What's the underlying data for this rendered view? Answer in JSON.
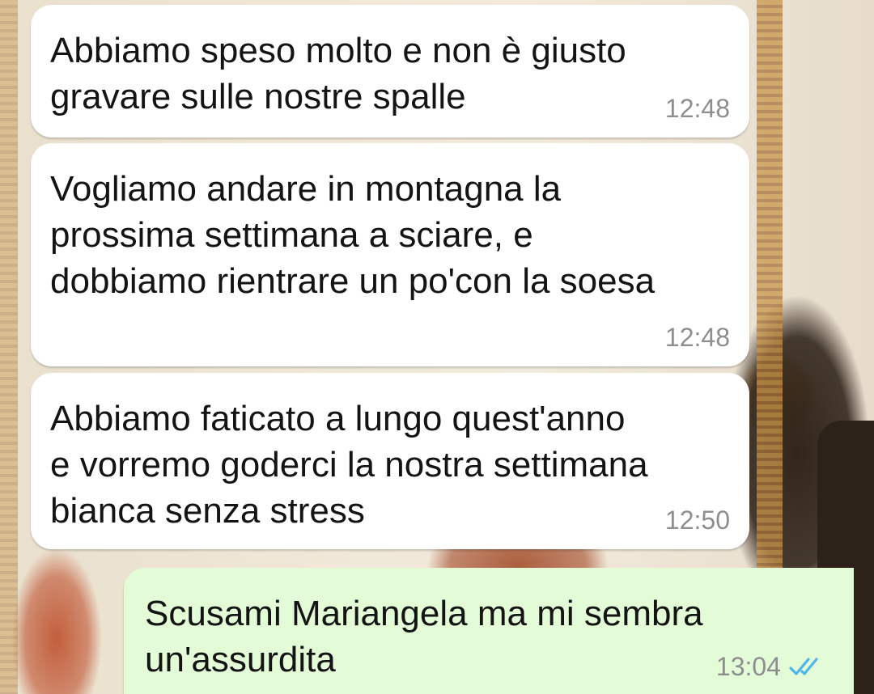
{
  "chat": {
    "messages": [
      {
        "direction": "incoming",
        "text": "Abbiamo speso molto e non è giusto\ngravare sulle nostre spalle",
        "time": "12:48"
      },
      {
        "direction": "incoming",
        "text": "Vogliamo andare in montagna la\nprossima settimana a sciare, e\ndobbiamo rientrare un po'con la soesa",
        "time": "12:48"
      },
      {
        "direction": "incoming",
        "text": "Abbiamo faticato a lungo quest'anno\ne vorremo goderci la nostra settimana\nbianca senza stress",
        "time": "12:50"
      },
      {
        "direction": "outgoing",
        "text": "Scusami Mariangela ma mi sembra\nun'assurdita",
        "time": "13:04",
        "status_icon": "double-check-read-icon"
      }
    ]
  },
  "colors": {
    "incoming_bubble": "#ffffff",
    "outgoing_bubble": "#e3fbd6",
    "read_ticks": "#4fb6ec",
    "timestamp": "#8e8e8e"
  }
}
